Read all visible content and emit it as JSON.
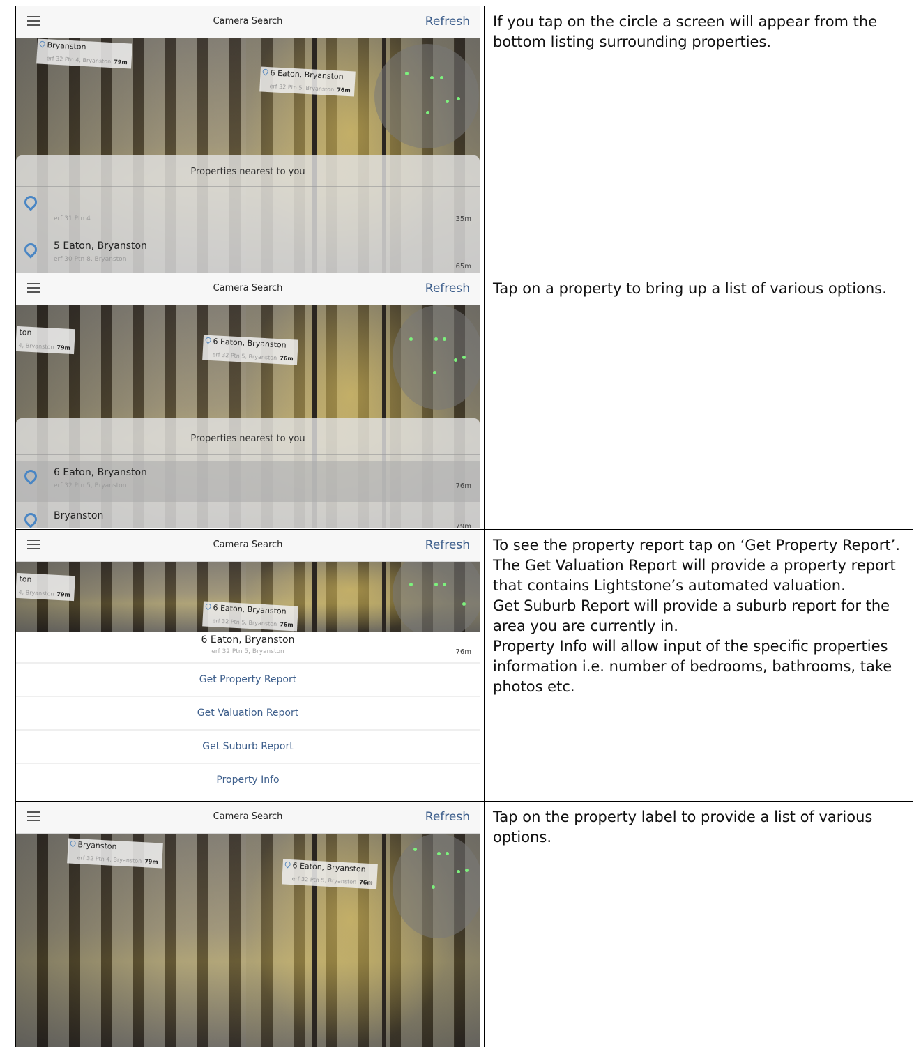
{
  "nav": {
    "title": "Camera Search",
    "refresh_label": "Refresh"
  },
  "rows": [
    {
      "description": "If you tap on the circle a screen will appear from the bottom listing surrounding properties.",
      "ar_labels": [
        {
          "name": "Bryanston",
          "sub": "erf 32 Ptn 4, Bryanston",
          "dist": "79m"
        },
        {
          "name": "6 Eaton, Bryanston",
          "sub": "erf 32 Ptn 5, Bryanston",
          "dist": "76m"
        }
      ],
      "sheet_title": "Properties nearest to you",
      "list": [
        {
          "name": "",
          "sub": "erf 31 Ptn 4",
          "dist": "35m"
        },
        {
          "name": "5 Eaton, Bryanston",
          "sub": "erf 30 Ptn 8, Bryanston",
          "dist": "65m"
        }
      ]
    },
    {
      "description": "Tap on a property to bring up a list of various options.",
      "ar_labels": [
        {
          "name": "ton",
          "sub": "4, Bryanston",
          "dist": "79m"
        },
        {
          "name": "6 Eaton, Bryanston",
          "sub": "erf 32 Ptn 5, Bryanston",
          "dist": "76m"
        }
      ],
      "sheet_title": "Properties nearest to you",
      "list": [
        {
          "name": "6 Eaton, Bryanston",
          "sub": "erf 32 Ptn 5, Bryanston",
          "dist": "76m"
        },
        {
          "name": "Bryanston",
          "sub": "",
          "dist": "79m"
        }
      ]
    },
    {
      "description_lines": [
        "To see the property report tap on ‘Get Property Report’.",
        "The Get Valuation Report will provide a property report that contains Lightstone’s automated valuation.",
        "Get Suburb Report will provide a suburb report for the area you are currently in.",
        "Property Info will allow input of the specific properties information i.e. number of bedrooms, bathrooms, take photos etc."
      ],
      "ar_labels": [
        {
          "name": "ton",
          "sub": "4, Bryanston",
          "dist": "79m"
        },
        {
          "name": "6 Eaton, Bryanston",
          "sub": "erf 32 Ptn 5, Bryanston",
          "dist": "76m"
        }
      ],
      "selected": {
        "name": "6 Eaton, Bryanston",
        "sub": "erf 32 Ptn 5, Bryanston",
        "dist": "76m"
      },
      "options": [
        "Get Property Report",
        "Get Valuation Report",
        "Get Suburb Report",
        "Property Info"
      ]
    },
    {
      "description": "Tap on the property label to provide a list of various options.",
      "ar_labels": [
        {
          "name": "Bryanston",
          "sub": "erf 32 Ptn 4, Bryanston",
          "dist": "79m"
        },
        {
          "name": "6 Eaton, Bryanston",
          "sub": "erf 32 Ptn 5, Bryanston",
          "dist": "76m"
        }
      ]
    }
  ],
  "colors": {
    "accent": "#3e5f8c",
    "radar_dot": "#7df17d",
    "pin": "#4a86c4"
  },
  "icons": [
    "menu-icon",
    "map-pin-icon"
  ]
}
